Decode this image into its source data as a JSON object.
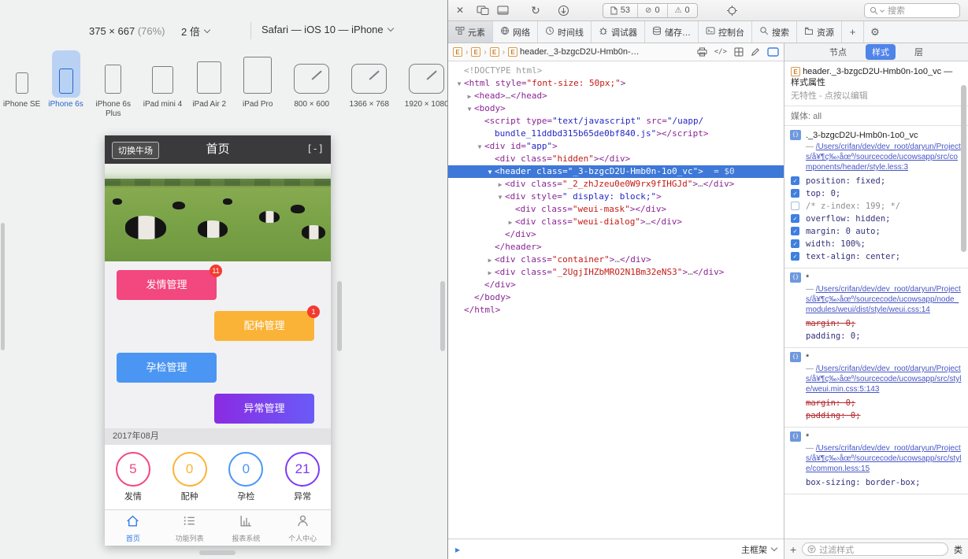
{
  "glyphs": {
    "close": "✕",
    "reload": "↻",
    "gear": "⚙",
    "plus": "+",
    "console_arrow": "▸",
    "crumb_sep": "›",
    "element_badge": "E",
    "rule_icon": "{}",
    "no_error": "⊘",
    "warning": "⚠",
    "code_view": "</>",
    "dash": "—",
    "app_control": "[-]"
  },
  "rdm": {
    "size_label": "375 × 667",
    "zoom_label": "(76%)",
    "scale_label": "2 倍",
    "ua_label": "Safari — iOS 10 — iPhone",
    "devices": [
      {
        "label": "iPhone SE",
        "type": "phone-s",
        "selected": false
      },
      {
        "label": "iPhone 6s",
        "type": "phone-m",
        "selected": true
      },
      {
        "label": "iPhone 6s Plus",
        "type": "phone-l",
        "selected": false
      },
      {
        "label": "iPad mini 4",
        "type": "tablet-s",
        "selected": false
      },
      {
        "label": "iPad Air 2",
        "type": "tablet-m",
        "selected": false
      },
      {
        "label": "iPad Pro",
        "type": "tablet-l",
        "selected": false
      },
      {
        "label": "800 × 600",
        "type": "screen",
        "selected": false
      },
      {
        "label": "1366 × 768",
        "type": "screen",
        "selected": false
      },
      {
        "label": "1920 × 1080",
        "type": "screen",
        "selected": false
      }
    ]
  },
  "app": {
    "header": {
      "switch_label": "切换牛场",
      "title": "首页"
    },
    "mgmt_buttons": [
      {
        "label": "发情管理",
        "badge": "11",
        "color": "#f2477f"
      },
      {
        "label": "配种管理",
        "badge": "1",
        "color": "#fbb337"
      },
      {
        "label": "孕检管理",
        "badge": "",
        "color": "#4b96f3"
      },
      {
        "label": "异常管理",
        "badge": "",
        "color": "#8a2be2",
        "color2": "#6a5bf7"
      }
    ],
    "month_label": "2017年08月",
    "stats": [
      {
        "value": "5",
        "label": "发情",
        "color": "#f2477f"
      },
      {
        "value": "0",
        "label": "配种",
        "color": "#fbb337"
      },
      {
        "value": "0",
        "label": "孕检",
        "color": "#4b96f3"
      },
      {
        "value": "21",
        "label": "异常",
        "color": "#7b3bf2"
      }
    ],
    "tabbar": [
      {
        "label": "首页",
        "icon": "home",
        "active": true
      },
      {
        "label": "功能列表",
        "icon": "list",
        "active": false
      },
      {
        "label": "报表系统",
        "icon": "report",
        "active": false
      },
      {
        "label": "个人中心",
        "icon": "user",
        "active": false
      }
    ]
  },
  "inspector": {
    "toolbar": {
      "resource_count": "53",
      "error_count": "0",
      "warning_count": "0",
      "search_placeholder": "搜索"
    },
    "tabs": [
      {
        "label": "元素",
        "icon": "elements",
        "selected": true
      },
      {
        "label": "网络",
        "icon": "network",
        "selected": false
      },
      {
        "label": "时间线",
        "icon": "timeline",
        "selected": false
      },
      {
        "label": "调试器",
        "icon": "debugger",
        "selected": false
      },
      {
        "label": "储存…",
        "icon": "storage",
        "selected": false
      },
      {
        "label": "控制台",
        "icon": "console",
        "selected": false
      },
      {
        "label": "搜索",
        "icon": "search",
        "selected": false
      },
      {
        "label": "资源",
        "icon": "resources",
        "selected": false
      }
    ],
    "breadcrumb": [
      {
        "label": ""
      },
      {
        "label": ""
      },
      {
        "label": ""
      },
      {
        "label": "header._3-bzgcD2U-Hmb0n-…"
      }
    ],
    "frame_label": "主框架",
    "dom_lines": [
      {
        "i": 0,
        "tk": [
          [
            "doc",
            "<!DOCTYPE html>"
          ]
        ]
      },
      {
        "i": 0,
        "a": "d",
        "tk": [
          [
            "tag",
            "<html"
          ],
          [
            "atr",
            " style="
          ],
          [
            "red",
            "\"font-size: 50px;\""
          ],
          [
            "tag",
            ">"
          ]
        ]
      },
      {
        "i": 1,
        "a": "r",
        "tk": [
          [
            "tag",
            "<head>"
          ],
          [
            "ell",
            "…"
          ],
          [
            "tag",
            "</head>"
          ]
        ]
      },
      {
        "i": 1,
        "a": "d",
        "tk": [
          [
            "tag",
            "<body>"
          ]
        ]
      },
      {
        "i": 2,
        "tk": [
          [
            "tag",
            "<script"
          ],
          [
            "atr",
            " type="
          ],
          [
            "blu",
            "\"text/javascript\""
          ],
          [
            "atr",
            " src="
          ],
          [
            "blu",
            "\"/uapp/"
          ]
        ]
      },
      {
        "i": 3,
        "tk": [
          [
            "blu",
            "bundle_11ddbd315b65de0bf840.js\""
          ],
          [
            "tag",
            "></script>"
          ]
        ]
      },
      {
        "i": 2,
        "a": "d",
        "tk": [
          [
            "tag",
            "<div"
          ],
          [
            "atr",
            " id="
          ],
          [
            "blu",
            "\"app\""
          ],
          [
            "tag",
            ">"
          ]
        ]
      },
      {
        "i": 3,
        "tk": [
          [
            "tag",
            "<div"
          ],
          [
            "atr",
            " class="
          ],
          [
            "red",
            "\"hidden\""
          ],
          [
            "tag",
            "></div>"
          ]
        ]
      },
      {
        "i": 3,
        "a": "d",
        "sel": true,
        "tk": [
          [
            "tag",
            "<header"
          ],
          [
            "atr",
            " class="
          ],
          [
            "red",
            "\"_3-bzgcD2U-Hmb0n-1o0_vc\""
          ],
          [
            "tag",
            ">"
          ],
          [
            "eq",
            "  = $0"
          ]
        ]
      },
      {
        "i": 4,
        "a": "r",
        "tk": [
          [
            "tag",
            "<div"
          ],
          [
            "atr",
            " class="
          ],
          [
            "red",
            "\"_2_zhJzeu0e0W9rx9fIHGJd\""
          ],
          [
            "tag",
            ">"
          ],
          [
            "ell",
            "…"
          ],
          [
            "tag",
            "</div>"
          ]
        ]
      },
      {
        "i": 4,
        "a": "d",
        "tk": [
          [
            "tag",
            "<div"
          ],
          [
            "atr",
            " style="
          ],
          [
            "blu",
            "\" display: block;\""
          ],
          [
            "tag",
            ">"
          ]
        ]
      },
      {
        "i": 5,
        "tk": [
          [
            "tag",
            "<div"
          ],
          [
            "atr",
            " class="
          ],
          [
            "red",
            "\"weui-mask\""
          ],
          [
            "tag",
            "></div>"
          ]
        ]
      },
      {
        "i": 5,
        "a": "r",
        "tk": [
          [
            "tag",
            "<div"
          ],
          [
            "atr",
            " class="
          ],
          [
            "red",
            "\"weui-dialog\""
          ],
          [
            "tag",
            ">"
          ],
          [
            "ell",
            "…"
          ],
          [
            "tag",
            "</div>"
          ]
        ]
      },
      {
        "i": 4,
        "tk": [
          [
            "tag",
            "</div>"
          ]
        ]
      },
      {
        "i": 3,
        "tk": [
          [
            "tag",
            "</header>"
          ]
        ]
      },
      {
        "i": 3,
        "a": "r",
        "tk": [
          [
            "tag",
            "<div"
          ],
          [
            "atr",
            " class="
          ],
          [
            "red",
            "\"container\""
          ],
          [
            "tag",
            ">"
          ],
          [
            "ell",
            "…"
          ],
          [
            "tag",
            "</div>"
          ]
        ]
      },
      {
        "i": 3,
        "a": "r",
        "tk": [
          [
            "tag",
            "<div"
          ],
          [
            "atr",
            " class="
          ],
          [
            "red",
            "\"_2UgjIHZbMRO2N1Bm32eNS3\""
          ],
          [
            "tag",
            ">"
          ],
          [
            "ell",
            "…"
          ],
          [
            "tag",
            "</div>"
          ]
        ]
      },
      {
        "i": 2,
        "tk": [
          [
            "tag",
            "</div>"
          ]
        ]
      },
      {
        "i": 1,
        "tk": [
          [
            "tag",
            "</body>"
          ]
        ]
      },
      {
        "i": 0,
        "tk": [
          [
            "tag",
            "</html>"
          ]
        ]
      }
    ]
  },
  "styles_panel": {
    "tabs": [
      {
        "label": "节点",
        "selected": false
      },
      {
        "label": "样式",
        "selected": true
      },
      {
        "label": "层",
        "selected": false
      }
    ],
    "element_title": "header._3-bzgcD2U-Hmb0n-1o0_vc — 样式属性",
    "no_attributes_hint": "无特性 - 点按以编辑",
    "media_label": "媒体: all",
    "rules": [
      {
        "selector": "._3-bzgcD2U-Hmb0n-1o0_vc",
        "source_link": "/Users/crifan/dev/dev_root/daryun/Projects/å¥¶ç‰›åœº/sourcecode/ucowsapp/src/components/header/style.less:3",
        "props": [
          {
            "chk": "on",
            "text": "position: fixed;"
          },
          {
            "chk": "on",
            "text": "top: 0;"
          },
          {
            "chk": "off",
            "text": "/* z-index: 199; */",
            "kind": "comment"
          },
          {
            "chk": "on",
            "text": "overflow: hidden;"
          },
          {
            "chk": "on",
            "text": "margin: 0 auto;"
          },
          {
            "chk": "on",
            "text": "width: 100%;"
          },
          {
            "chk": "on",
            "text": "text-align: center;"
          }
        ]
      },
      {
        "selector": "*",
        "source_link": "/Users/crifan/dev/dev_root/daryun/Projects/å¥¶ç‰›åœº/sourcecode/ucowsapp/node_modules/weui/dist/style/weui.css:14",
        "props": [
          {
            "text": "margin: 0;",
            "kind": "strike"
          },
          {
            "text": "padding: 0;"
          }
        ]
      },
      {
        "selector": "*",
        "source_link": "/Users/crifan/dev/dev_root/daryun/Projects/å¥¶ç‰›åœº/sourcecode/ucowsapp/src/style/weui.min.css:5:143",
        "props": [
          {
            "text": "margin: 0;",
            "kind": "strike"
          },
          {
            "text": "padding: 0;",
            "kind": "strike"
          }
        ]
      },
      {
        "selector": "*",
        "source_link": "/Users/crifan/dev/dev_root/daryun/Projects/å¥¶ç‰›åœº/sourcecode/ucowsapp/src/style/common.less:15",
        "props": [
          {
            "text": "box-sizing: border-box;"
          }
        ]
      }
    ],
    "filter_placeholder": "过滤样式",
    "classes_label": "类"
  }
}
